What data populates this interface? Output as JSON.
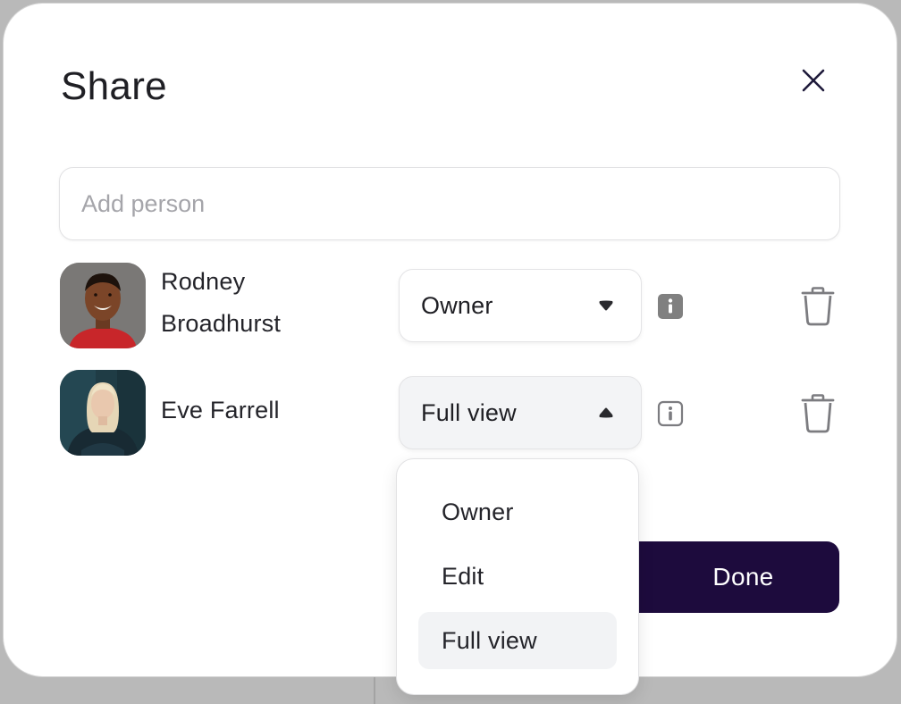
{
  "dialog": {
    "title": "Share",
    "close_icon": "close-icon"
  },
  "add_person": {
    "placeholder": "Add person",
    "value": ""
  },
  "people": [
    {
      "name_line1": "Rodney",
      "name_line2": "Broadhurst",
      "role": "Owner",
      "dropdown_open": false
    },
    {
      "name_line1": "Eve Farrell",
      "role": "Full view",
      "dropdown_open": true
    }
  ],
  "role_menu": {
    "options": [
      "Owner",
      "Edit",
      "Full view"
    ],
    "selected": "Full view"
  },
  "done_label": "Done",
  "colors": {
    "primary": "#1d0b3d",
    "info_filled": "#808080",
    "text": "#1f1f24"
  }
}
